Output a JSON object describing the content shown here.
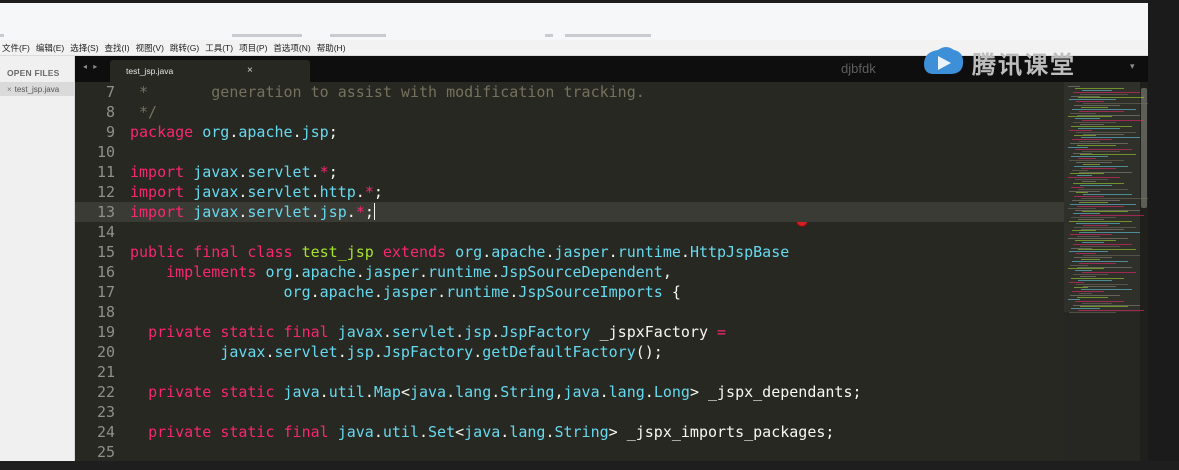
{
  "menu": {
    "items": [
      "文件(F)",
      "编辑(E)",
      "选择(S)",
      "查找(I)",
      "视图(V)",
      "跳转(G)",
      "工具(T)",
      "项目(P)",
      "首选项(N)",
      "帮助(H)"
    ]
  },
  "sidebar": {
    "header": "OPEN FILES",
    "files": [
      {
        "close": "×",
        "name": "test_jsp.java"
      }
    ]
  },
  "tabs": {
    "nav": "◂ ▸",
    "active": {
      "label": "test_jsp.java",
      "close": "×"
    },
    "watermark": "djbfdk",
    "overflow": "▾"
  },
  "brand": {
    "name": "腾讯课堂"
  },
  "editor": {
    "current_line": 13,
    "lines": [
      {
        "n": "7",
        "code": " *       generation to assist with modification tracking."
      },
      {
        "n": "8",
        "code": " */"
      },
      {
        "n": "9",
        "code": "package org.apache.jsp;"
      },
      {
        "n": "10",
        "code": ""
      },
      {
        "n": "11",
        "code": "import javax.servlet.*;"
      },
      {
        "n": "12",
        "code": "import javax.servlet.http.*;"
      },
      {
        "n": "13",
        "code": "import javax.servlet.jsp.*;"
      },
      {
        "n": "14",
        "code": ""
      },
      {
        "n": "15",
        "code": "public final class test_jsp extends org.apache.jasper.runtime.HttpJspBase"
      },
      {
        "n": "16",
        "code": "    implements org.apache.jasper.runtime.JspSourceDependent,"
      },
      {
        "n": "17",
        "code": "                 org.apache.jasper.runtime.JspSourceImports {"
      },
      {
        "n": "18",
        "code": ""
      },
      {
        "n": "19",
        "code": "  private static final javax.servlet.jsp.JspFactory _jspxFactory ="
      },
      {
        "n": "20",
        "code": "          javax.servlet.jsp.JspFactory.getDefaultFactory();"
      },
      {
        "n": "21",
        "code": ""
      },
      {
        "n": "22",
        "code": "  private static java.util.Map<java.lang.String,java.lang.Long> _jspx_dependants;"
      },
      {
        "n": "23",
        "code": ""
      },
      {
        "n": "24",
        "code": "  private static final java.util.Set<java.lang.String> _jspx_imports_packages;"
      },
      {
        "n": "25",
        "code": ""
      }
    ]
  },
  "colors": {
    "editor_bg": "#272822",
    "keyword": "#f92672",
    "type": "#66d9ef",
    "class_name": "#a6e22e",
    "comment": "#75715e",
    "text": "#f8f8f2"
  }
}
